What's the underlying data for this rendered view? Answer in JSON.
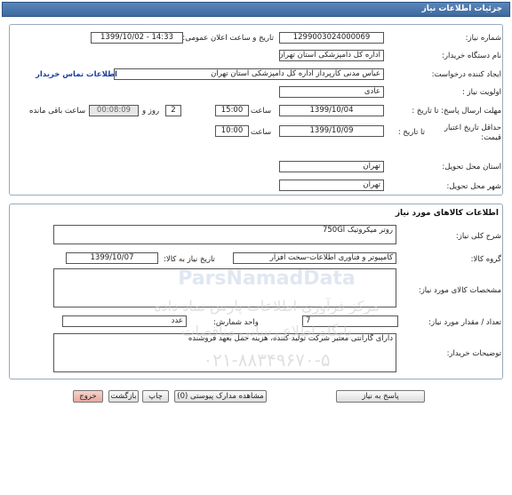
{
  "window": {
    "title": "جزئیات اطلاعات نیاز"
  },
  "details": {
    "need_number_label": "شماره نیاز:",
    "need_number": "1299003024000069",
    "announce_label": "تاریخ و ساعت اعلان عمومی:",
    "announce_value": "1399/10/02 - 14:33",
    "buyer_org_label": "نام دستگاه خریدار:",
    "buyer_org": "اداره کل  دامپزشکی استان  تهران",
    "requester_label": "ایجاد کننده درخواست:",
    "requester": "عباس  مدنی کارپرداز اداره کل  دامپزشکی استان  تهران",
    "contact_link": "اطلاعات تماس خریدار",
    "priority_label": "اولویت نیاز :",
    "priority": "عادی",
    "deadline_label": "مهلت ارسال پاسخ: تا تاریخ :",
    "deadline_date": "1399/10/04",
    "time_label": "ساعت",
    "deadline_time": "15:00",
    "days_value": "2",
    "days_label": "روز و",
    "remaining_time": "00:08:09",
    "remaining_label": "ساعت باقی مانده",
    "min_validity_label_1": "حداقل تاریخ اعتبار",
    "min_validity_label_2": "قیمت:",
    "validity_to_label": "تا تاریخ :",
    "validity_date": "1399/10/09",
    "validity_time": "10:00",
    "province_label": "استان محل تحویل:",
    "province": "تهران",
    "city_label": "شهر محل تحویل:",
    "city": "تهران"
  },
  "goods": {
    "section_title": "اطلاعات کالاهای مورد نیاز",
    "summary_label": "شرح کلی نیاز:",
    "summary": "روتر میکروتیک 750Gl",
    "group_label": "گروه کالا:",
    "group": "کامپیوتر و فناوری اطلاعات-سخت افزار",
    "need_date_label": "تاریخ نیاز به کالا:",
    "need_date": "1399/10/07",
    "specs_label": "مشخصات کالای مورد نیاز:",
    "specs": "",
    "qty_label": "تعداد / مقدار مورد نیاز:",
    "qty": "7",
    "unit_label": "واحد شمارش:",
    "unit": "عدد",
    "buyer_notes_label": "توضیحات خریدار:",
    "buyer_notes": "دارای گارانتی معتبر شرکت تولید کننده، هزینه حمل بعهد فروشنده"
  },
  "buttons": {
    "reply": "پاسخ به نیاز",
    "attachments": "مشاهده مدارک پیوستی (0)",
    "print": "چاپ",
    "back": "بازگشت",
    "exit": "خروج"
  },
  "watermark": {
    "brand": "ParsNamadData",
    "line1": "مرکز فرآوری اطلاعات پارس نماد داده",
    "line2": "پایگاه اطلاع رسانی مناقصات",
    "phone": "۰۲۱-۸۸۳۴۹۶۷۰-۵"
  },
  "colors": {
    "title_bar": "#3d6aa0",
    "link": "#1a3e9e",
    "exit_button": "#f2b8b0"
  }
}
